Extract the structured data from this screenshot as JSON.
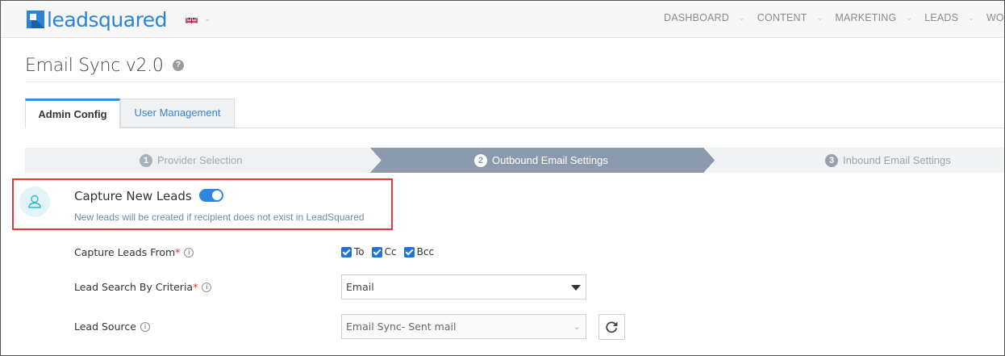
{
  "header": {
    "logo_text": "leadsquared",
    "language": "uk-flag-icon",
    "nav": [
      {
        "label": "DASHBOARD"
      },
      {
        "label": "CONTENT"
      },
      {
        "label": "MARKETING"
      },
      {
        "label": "LEADS"
      },
      {
        "label": "WORK"
      }
    ]
  },
  "page": {
    "title": "Email Sync v2.0",
    "help": "?"
  },
  "tabs": {
    "admin": "Admin Config",
    "user": "User Management"
  },
  "steps": [
    {
      "num": "1",
      "label": "Provider Selection",
      "state": "done"
    },
    {
      "num": "2",
      "label": "Outbound Email Settings",
      "state": "active"
    },
    {
      "num": "3",
      "label": "Inbound Email Settings",
      "state": "pending"
    }
  ],
  "capture": {
    "title": "Capture New Leads",
    "enabled": true,
    "description": "New leads will be created if recipient does not exist in LeadSquared"
  },
  "form": {
    "capture_from": {
      "label": "Capture Leads From",
      "required": "*",
      "options": [
        {
          "label": "To",
          "checked": true
        },
        {
          "label": "Cc",
          "checked": true
        },
        {
          "label": "Bcc",
          "checked": true
        }
      ]
    },
    "search_criteria": {
      "label": "Lead Search By Criteria",
      "required": "*",
      "value": "Email"
    },
    "lead_source": {
      "label": "Lead Source",
      "value": "Email Sync- Sent mail"
    }
  },
  "colors": {
    "brand": "#2b83d6",
    "active_step": "#8c9aad",
    "highlight_border": "#e53935"
  }
}
